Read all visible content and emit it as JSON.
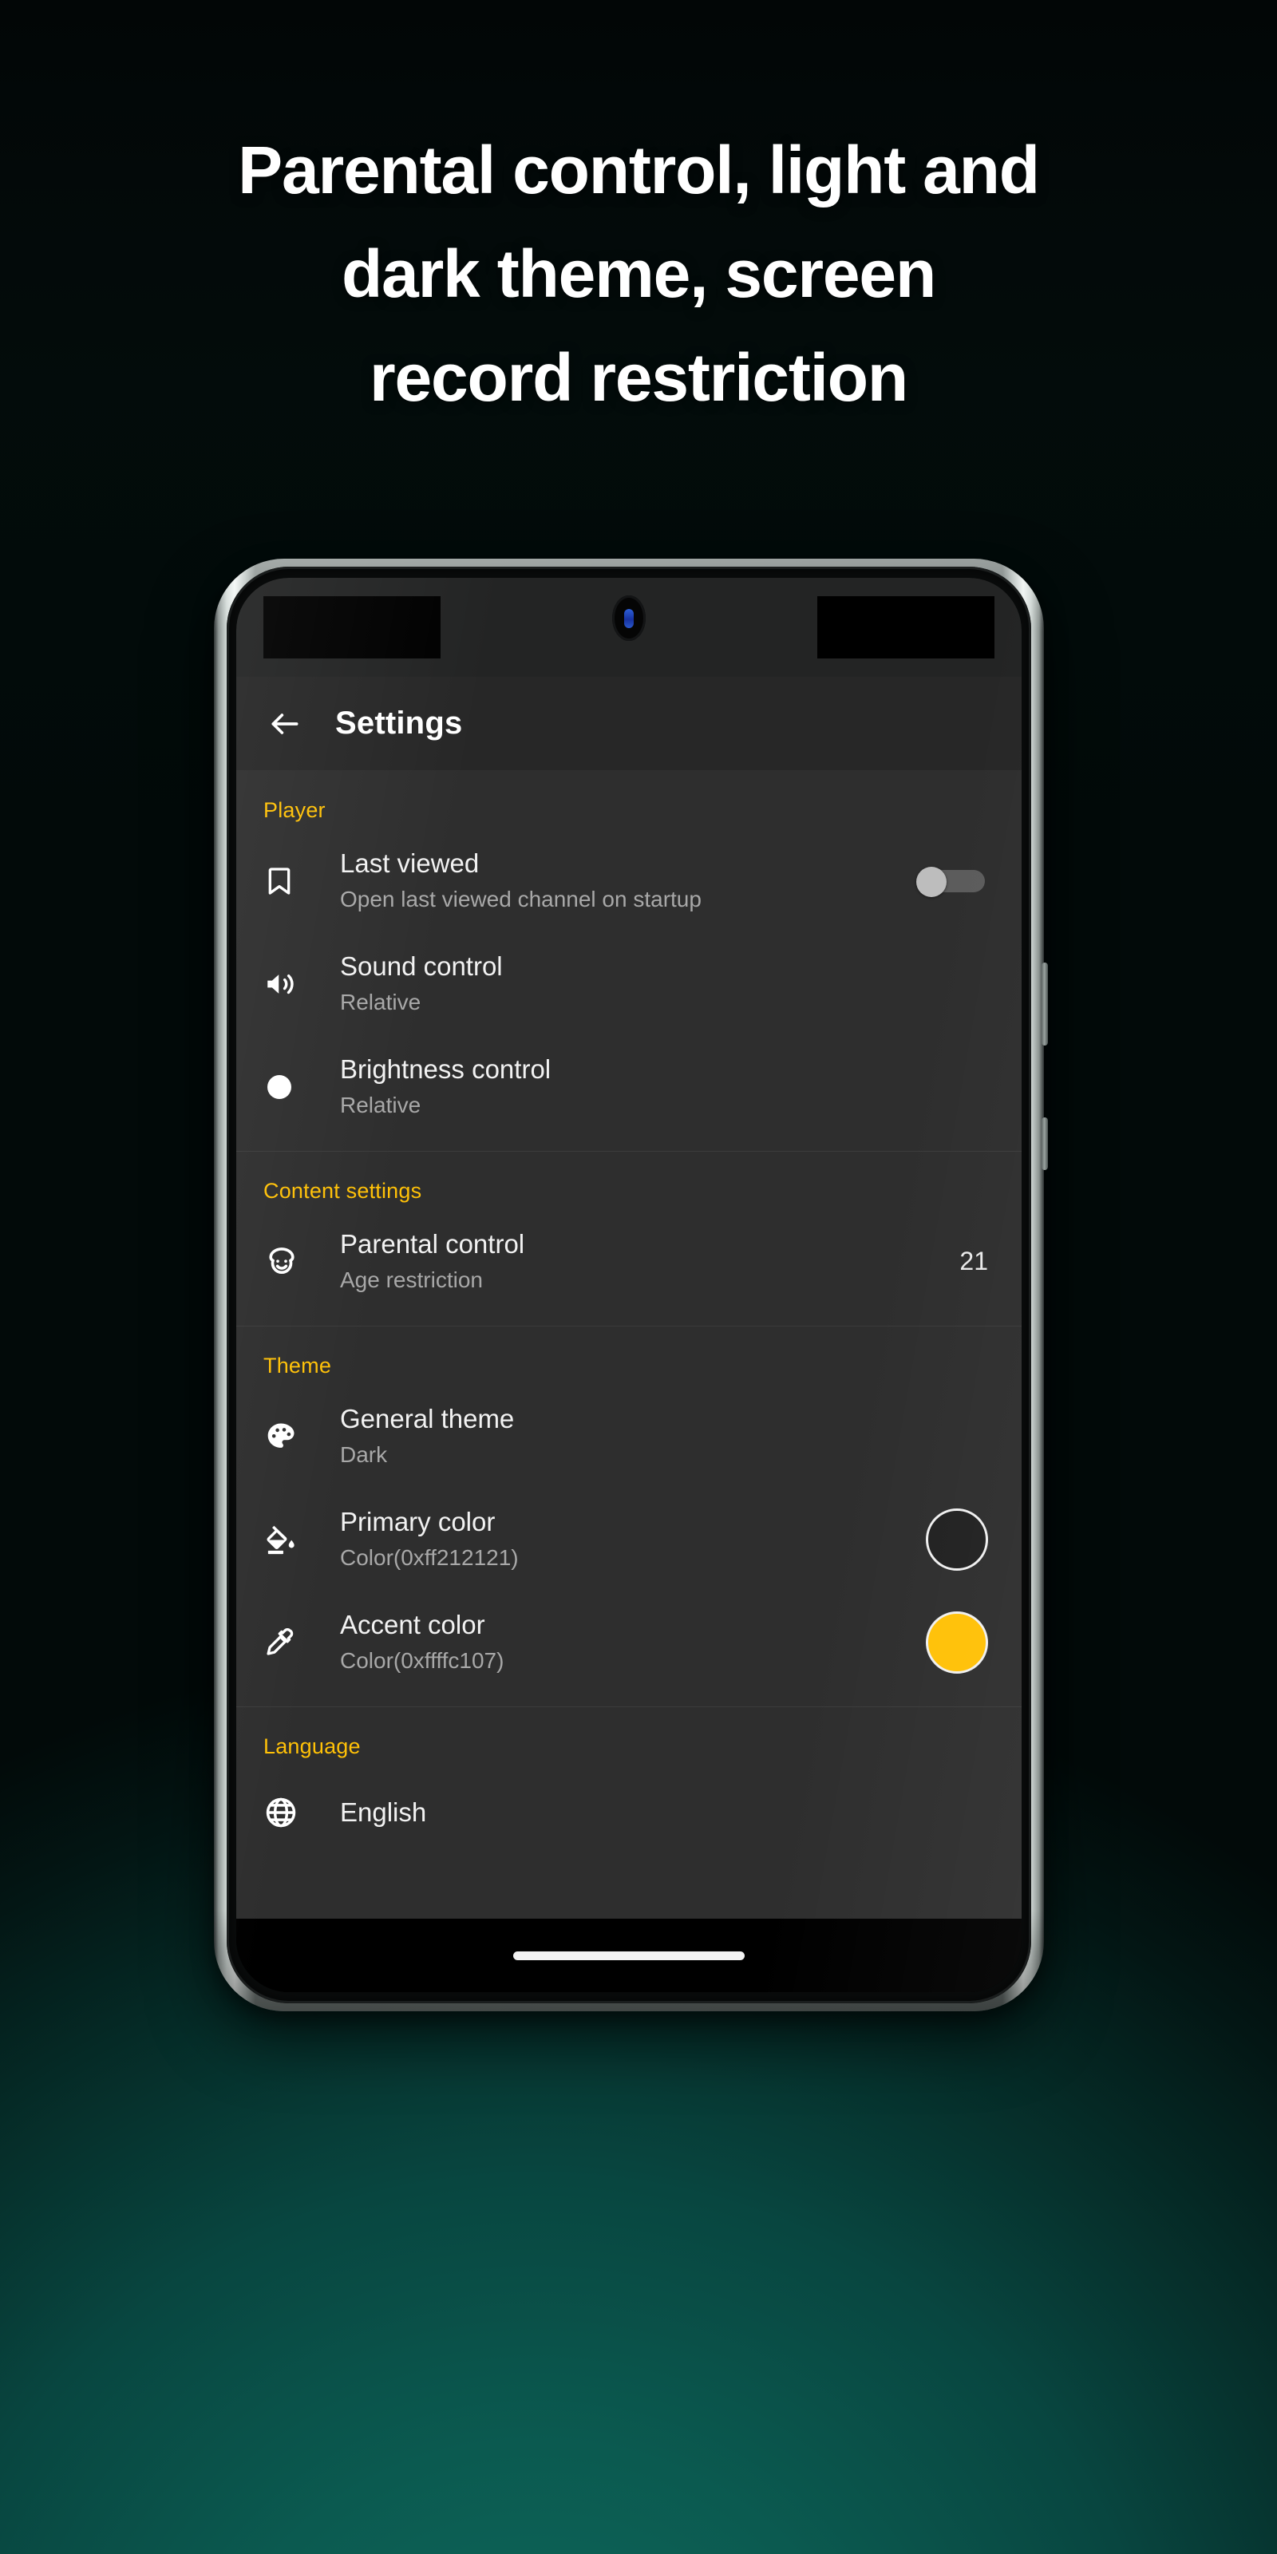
{
  "headline": {
    "lines": [
      "Parental control, light and",
      "dark theme, screen",
      "record restriction"
    ]
  },
  "colors": {
    "accent_amber": "#ffc107",
    "section_header": "#ffc107",
    "app_bar_bg": "#272727",
    "body_bg": "#2e2e2e",
    "status_bar_bg": "#232424",
    "primary_swatch": "#212121",
    "accent_swatch": "#ffc107",
    "background_teal": "#0b6459"
  },
  "phone": {
    "app_bar": {
      "back_icon": "arrow-left-icon",
      "title": "Settings"
    },
    "nav_bar": {
      "gesture_pill": "home-gesture-pill"
    },
    "sections": [
      {
        "title": "Player",
        "rows": [
          {
            "icon": "bookmark-icon",
            "title": "Last viewed",
            "subtitle": "Open last viewed channel on startup",
            "trailing_type": "toggle",
            "trailing_value": "off"
          },
          {
            "icon": "volume-up-icon",
            "title": "Sound control",
            "subtitle": "Relative",
            "trailing_type": "none",
            "trailing_value": ""
          },
          {
            "icon": "brightness-circle-icon",
            "title": "Brightness control",
            "subtitle": "Relative",
            "trailing_type": "none",
            "trailing_value": ""
          }
        ]
      },
      {
        "title": "Content settings",
        "rows": [
          {
            "icon": "child-face-icon",
            "title": "Parental control",
            "subtitle": "Age restriction",
            "trailing_type": "value",
            "trailing_value": "21"
          }
        ]
      },
      {
        "title": "Theme",
        "rows": [
          {
            "icon": "palette-icon",
            "title": "General theme",
            "subtitle": "Dark",
            "trailing_type": "none",
            "trailing_value": ""
          },
          {
            "icon": "paint-bucket-icon",
            "title": "Primary color",
            "subtitle": "Color(0xff212121)",
            "trailing_type": "swatch-primary",
            "trailing_value": "#212121"
          },
          {
            "icon": "eyedropper-icon",
            "title": "Accent color",
            "subtitle": "Color(0xffffc107)",
            "trailing_type": "swatch-accent",
            "trailing_value": "#ffc107"
          }
        ]
      },
      {
        "title": "Language",
        "rows": [
          {
            "icon": "globe-icon",
            "title": "English",
            "subtitle": "",
            "trailing_type": "none",
            "trailing_value": ""
          }
        ]
      }
    ]
  }
}
